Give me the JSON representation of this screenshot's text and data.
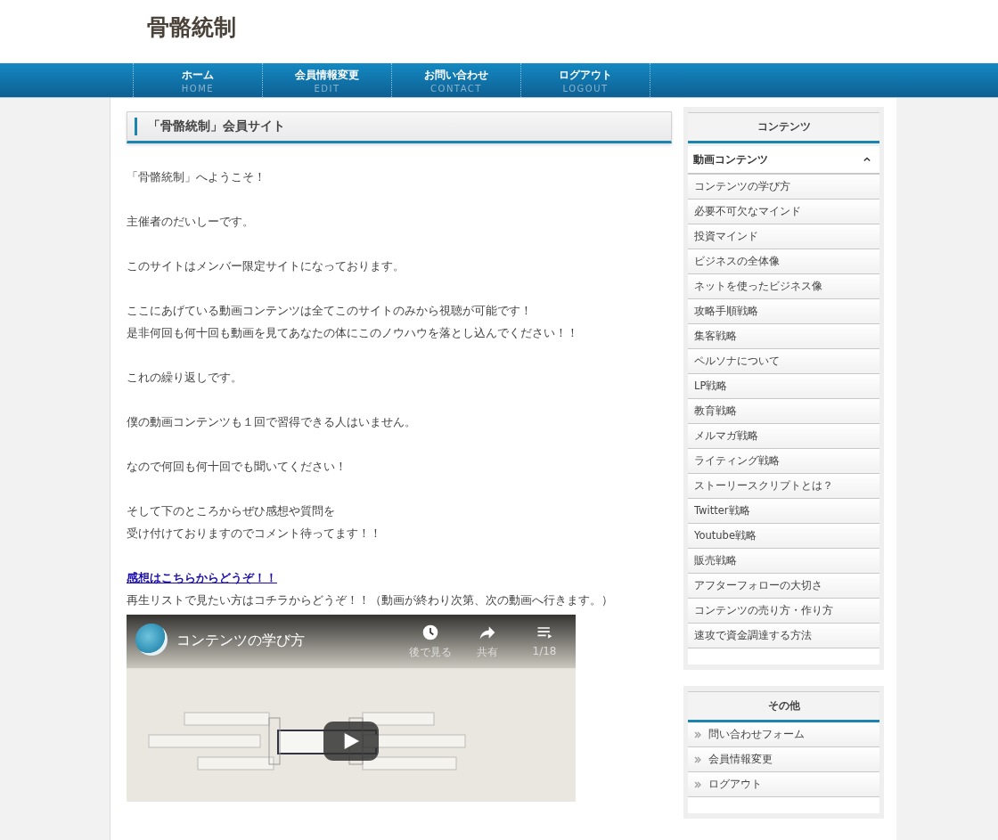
{
  "site_title": "骨骼統制",
  "nav": [
    {
      "label": "ホーム",
      "sub": "HOME"
    },
    {
      "label": "会員情報変更",
      "sub": "EDIT"
    },
    {
      "label": "お問い合わせ",
      "sub": "CONTACT"
    },
    {
      "label": "ログアウト",
      "sub": "LOGOUT"
    }
  ],
  "page_heading": "「骨骼統制」会員サイト",
  "paragraphs": [
    [
      "「骨骼統制」へようこそ！"
    ],
    [
      "主催者のだいしーです。"
    ],
    [
      "このサイトはメンバー限定サイトになっております。"
    ],
    [
      "ここにあげている動画コンテンツは全てこのサイトのみから視聴が可能です！",
      "是非何回も何十回も動画を見てあなたの体にこのノウハウを落とし込んでください！！"
    ],
    [
      "これの繰り返しです。"
    ],
    [
      "僕の動画コンテンツも１回で習得できる人はいません。"
    ],
    [
      "なので何回も何十回でも聞いてください！"
    ],
    [
      "そして下のところからぜひ感想や質問を",
      "受け付けておりますのでコメント待ってます！！"
    ]
  ],
  "feedback_link": "感想はこちらからどうぞ！！",
  "playlist_note": "再生リストで見たい方はコチラからどうぞ！！（動画が終わり次第、次の動画へ行きます。）",
  "video": {
    "title": "コンテンツの学び方",
    "actions": [
      {
        "kind": "watch_later",
        "label": "後で見る"
      },
      {
        "kind": "share",
        "label": "共有"
      },
      {
        "kind": "playlist",
        "label": "1/18"
      }
    ]
  },
  "sidebar": [
    {
      "heading": "コンテンツ",
      "group": {
        "label": "動画コンテンツ",
        "expanded": true
      },
      "kind": "plain",
      "items": [
        "コンテンツの学び方",
        "必要不可欠なマインド",
        "投資マインド",
        "ビジネスの全体像",
        "ネットを使ったビジネス像",
        "攻略手順戦略",
        "集客戦略",
        "ペルソナについて",
        "LP戦略",
        "教育戦略",
        "メルマガ戦略",
        "ライティング戦略",
        "ストーリースクリプトとは？",
        "Twitter戦略",
        "Youtube戦略",
        "販売戦略",
        "アフターフォローの大切さ",
        "コンテンツの売り方・作り方",
        "速攻で資金調達する方法"
      ]
    },
    {
      "heading": "その他",
      "kind": "chevron",
      "items": [
        "問い合わせフォーム",
        "会員情報変更",
        "ログアウト"
      ]
    }
  ]
}
